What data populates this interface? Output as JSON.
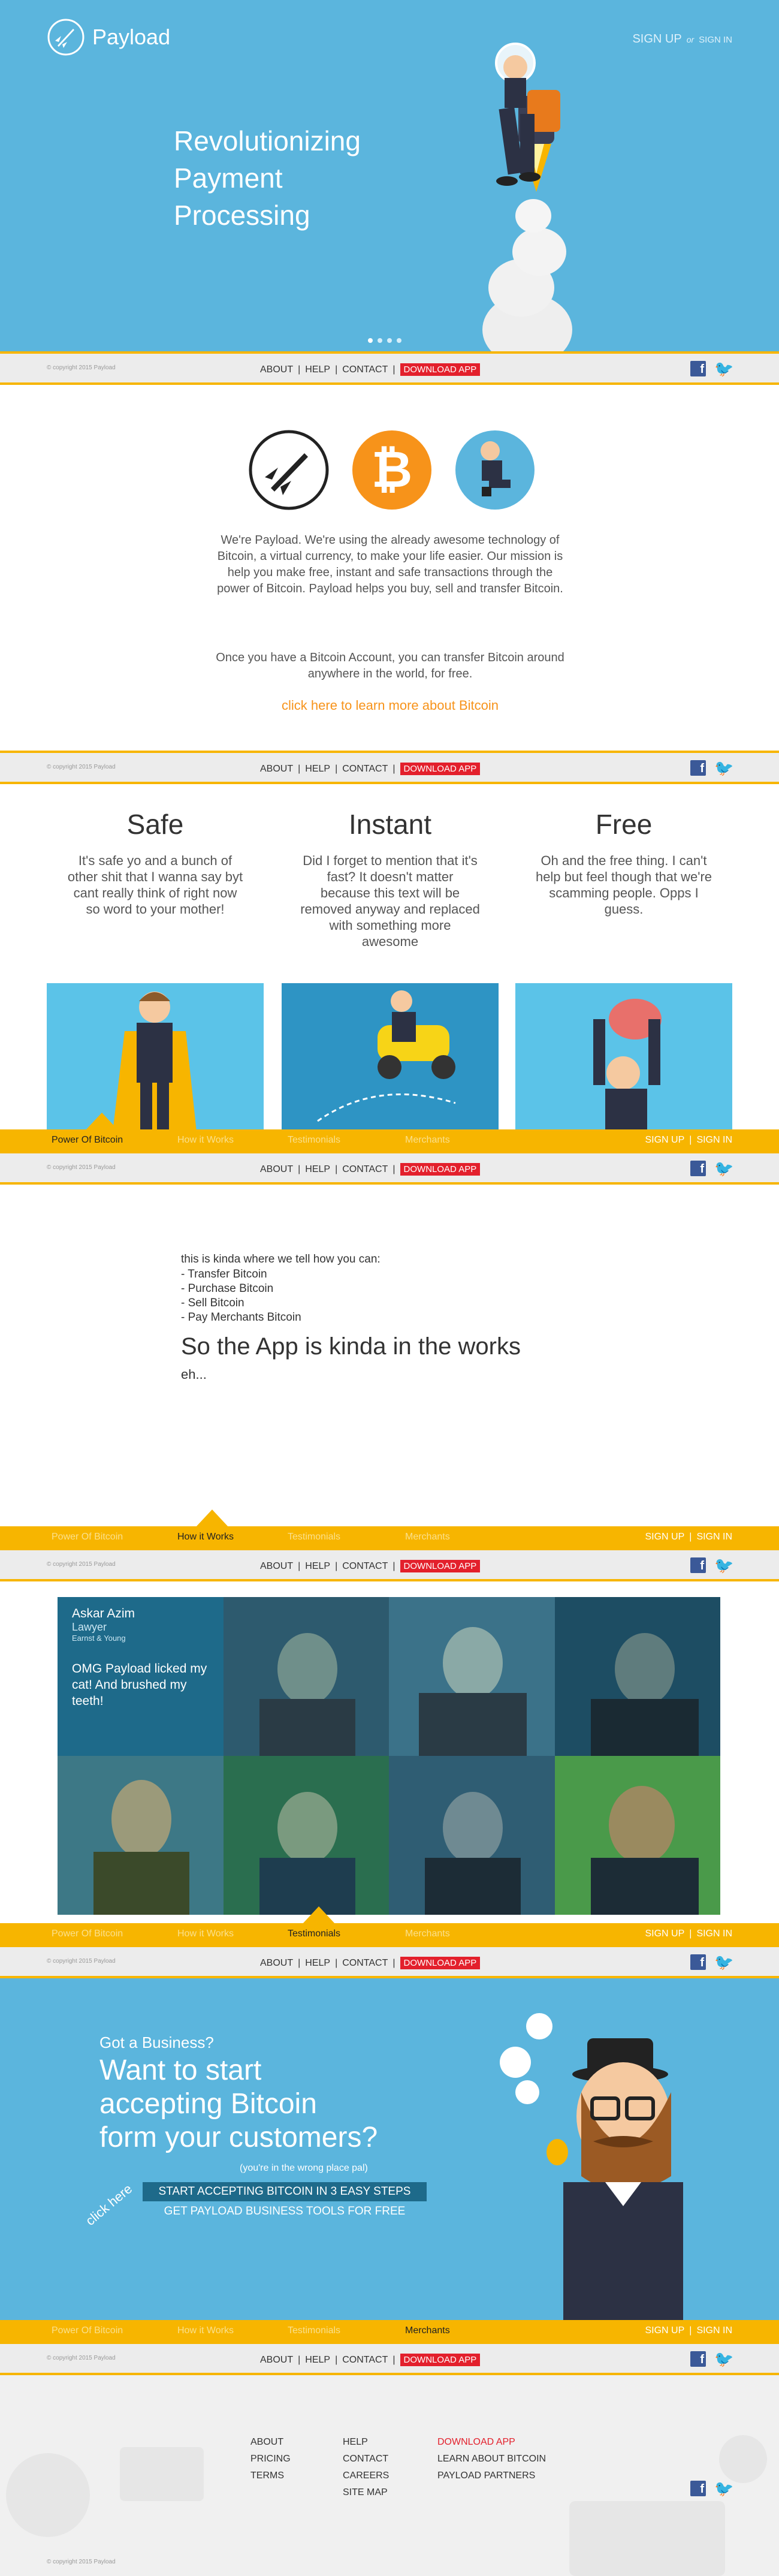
{
  "header": {
    "logo": "Payload",
    "signup": "SIGN UP",
    "or": "or",
    "signin": "SIGN IN",
    "hero_title": [
      "Revolutionizing",
      "Payment",
      "Processing"
    ]
  },
  "footer": {
    "copyright": "© copyright 2015 Payload",
    "about": "ABOUT",
    "help": "HELP",
    "contact": "CONTACT",
    "download": "DOWNLOAD APP",
    "sep": "|"
  },
  "intro": {
    "p1": "We're Payload. We're using the already awesome technology of Bitcoin, a virtual currency, to make your life easier. Our mission is help you make free, instant and safe transactions through the power of Bitcoin. Payload helps you buy, sell and transfer Bitcoin.",
    "p2": "Once you have a Bitcoin Account, you can transfer Bitcoin around anywhere in the world, for free.",
    "link": "click here to learn more about Bitcoin"
  },
  "features": [
    {
      "title": "Safe",
      "text": "It's safe yo and a bunch of other shit that I wanna say byt cant really think of right now so word to your mother!"
    },
    {
      "title": "Instant",
      "text": "Did I forget to mention that it's fast? It doesn't matter because this text will be removed anyway and replaced with something more awesome"
    },
    {
      "title": "Free",
      "text": "Oh and the free thing. I can't help but feel though that we're scamming people. Opps I guess."
    }
  ],
  "nav": {
    "items": [
      "Power Of Bitcoin",
      "How it Works",
      "Testimonials",
      "Merchants"
    ],
    "signup": "SIGN UP",
    "signin": "SIGN IN",
    "sep": "|"
  },
  "how": {
    "intro": "this is kinda where we tell how you can:",
    "steps": [
      "- Transfer Bitcoin",
      "- Purchase Bitcoin",
      "- Sell Bitcoin",
      "- Pay Merchants Bitcoin"
    ],
    "headline": "So the App is kinda in the works",
    "sub": "eh..."
  },
  "testimonial": {
    "name": "Askar Azim",
    "role": "Lawyer",
    "company": "Earnst & Young",
    "quote": "OMG Payload licked my cat! And brushed my teeth!"
  },
  "merchants": {
    "kicker": "Got a Business?",
    "headline": [
      "Want to start",
      "accepting Bitcoin",
      "form your customers?"
    ],
    "aside": "(you're in the wrong place pal)",
    "click": "click here",
    "cta1": "START ACCEPTING BITCOIN IN 3 EASY STEPS",
    "cta2": "GET PAYLOAD BUSINESS TOOLS FOR FREE"
  },
  "sitemap": {
    "col1": [
      "ABOUT",
      "PRICING",
      "TERMS"
    ],
    "col2": [
      "HELP",
      "CONTACT",
      "CAREERS",
      "SITE MAP"
    ],
    "col3": [
      "DOWNLOAD APP",
      "LEARN ABOUT BITCOIN",
      "PAYLOAD PARTNERS"
    ]
  },
  "colors": {
    "blue": "#5bb5dd",
    "yellow": "#f7b500",
    "orange": "#f7931a",
    "red": "#e3202c"
  }
}
